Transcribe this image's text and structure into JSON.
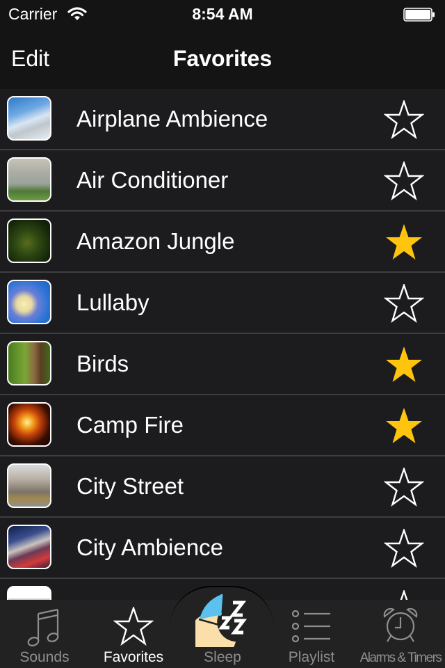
{
  "status_bar": {
    "carrier": "Carrier",
    "time": "8:54 AM",
    "wifi_icon": "wifi-icon",
    "battery_icon": "battery-full-icon"
  },
  "nav_bar": {
    "edit_label": "Edit",
    "title": "Favorites"
  },
  "colors": {
    "favorite_star": "#FFC40D",
    "unfavorite_star_outline": "#FFFFFF",
    "list_bg": "#1C1C1E",
    "separator": "#3E3E40",
    "tab_active": "#FFFFFF",
    "tab_inactive": "#8E8E8E",
    "sleep_cap": "#5BC1EE",
    "sleep_moon": "#FBDFAA"
  },
  "sounds": [
    {
      "name": "Airplane Ambience",
      "favorite": false,
      "thumb": "airplane"
    },
    {
      "name": "Air Conditioner",
      "favorite": false,
      "thumb": "air-conditioner"
    },
    {
      "name": "Amazon Jungle",
      "favorite": true,
      "thumb": "jungle"
    },
    {
      "name": "Lullaby",
      "favorite": false,
      "thumb": "lullaby"
    },
    {
      "name": "Birds",
      "favorite": true,
      "thumb": "birds"
    },
    {
      "name": "Camp Fire",
      "favorite": true,
      "thumb": "campfire"
    },
    {
      "name": "City Street",
      "favorite": false,
      "thumb": "city-street"
    },
    {
      "name": "City Ambience",
      "favorite": false,
      "thumb": "city-ambience"
    },
    {
      "name": "",
      "favorite": false,
      "thumb": "clock"
    }
  ],
  "tab_bar": {
    "tabs": [
      {
        "label": "Sounds",
        "icon": "music-note-icon",
        "active": false
      },
      {
        "label": "Favorites",
        "icon": "star-icon",
        "active": true
      },
      {
        "label": "Sleep",
        "icon": "sleep-moon-icon",
        "active": false
      },
      {
        "label": "Playlist",
        "icon": "list-icon",
        "active": false
      },
      {
        "label": "Alarms & Timers",
        "icon": "alarm-clock-icon",
        "active": false
      }
    ]
  }
}
